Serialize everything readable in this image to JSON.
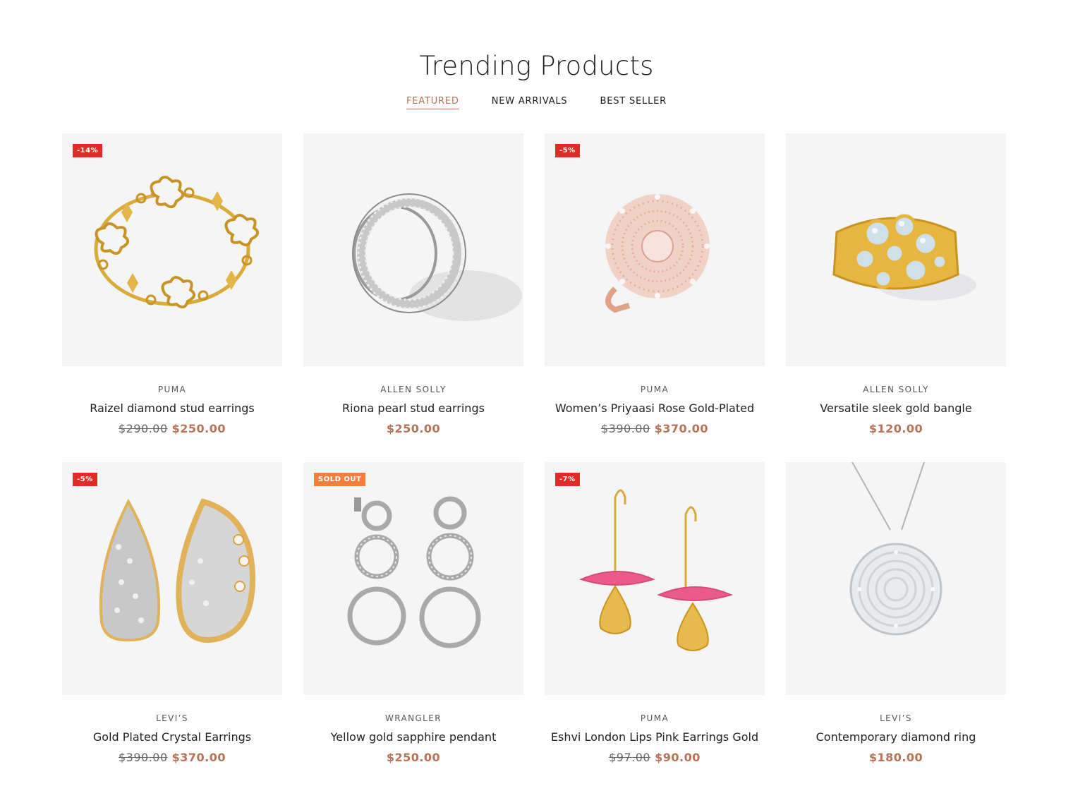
{
  "section": {
    "title": "Trending Products",
    "tabs": [
      {
        "label": "FEATURED",
        "active": true
      },
      {
        "label": "NEW ARRIVALS",
        "active": false
      },
      {
        "label": "BEST SELLER",
        "active": false
      }
    ]
  },
  "colors": {
    "accent": "#b5735a",
    "sale_badge": "#e02b27",
    "sold_badge": "#f2803c",
    "tile_bg": "#f5f5f5"
  },
  "products": [
    {
      "brand": "PUMA",
      "name": "Raizel diamond stud earrings",
      "old_price": "$290.00",
      "price": "$250.00",
      "badge": "-14%",
      "image": "gold-bracelet"
    },
    {
      "brand": "ALLEN SOLLY",
      "name": "Riona pearl stud earrings",
      "old_price": "",
      "price": "$250.00",
      "badge": "",
      "image": "silver-band-ring"
    },
    {
      "brand": "PUMA",
      "name": "Women’s Priyaasi Rose Gold-Plated",
      "old_price": "$390.00",
      "price": "$370.00",
      "badge": "-5%",
      "image": "rose-gold-cocktail-ring"
    },
    {
      "brand": "ALLEN SOLLY",
      "name": "Versatile sleek gold bangle",
      "old_price": "",
      "price": "$120.00",
      "badge": "",
      "image": "gold-diamond-ring"
    },
    {
      "brand": "LEVI’S",
      "name": "Gold Plated Crystal Earrings",
      "old_price": "$390.00",
      "price": "$370.00",
      "badge": "-5%",
      "image": "crystal-hoop-earrings"
    },
    {
      "brand": "WRANGLER",
      "name": "Yellow gold sapphire pendant",
      "old_price": "",
      "price": "$250.00",
      "badge": "SOLD OUT",
      "image": "silver-circle-earrings"
    },
    {
      "brand": "PUMA",
      "name": "Eshvi London Lips Pink Earrings Gold",
      "old_price": "$97.00",
      "price": "$90.00",
      "badge": "-7%",
      "image": "pink-lips-earrings"
    },
    {
      "brand": "LEVI’S",
      "name": "Contemporary diamond ring",
      "old_price": "",
      "price": "$180.00",
      "badge": "",
      "image": "diamond-pendant-necklace"
    }
  ]
}
